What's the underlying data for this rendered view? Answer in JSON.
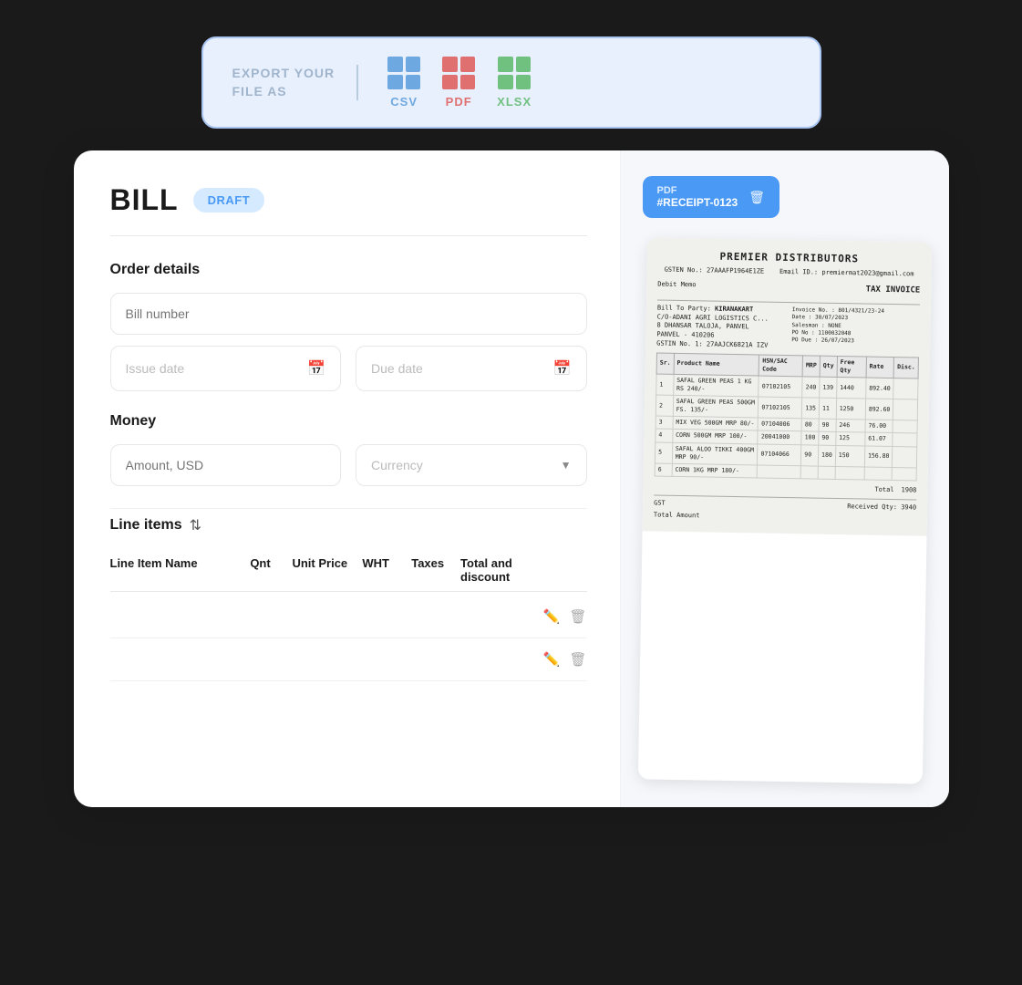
{
  "export_bar": {
    "label": "EXPORT YOUR\nFILE AS",
    "options": [
      {
        "id": "csv",
        "label": "CSV"
      },
      {
        "id": "pdf",
        "label": "PDF"
      },
      {
        "id": "xlsx",
        "label": "XLSX"
      }
    ]
  },
  "bill": {
    "title": "BILL",
    "status": "DRAFT",
    "order_details": {
      "section_title": "Order details",
      "bill_number_placeholder": "Bill number",
      "issue_date_placeholder": "Issue date",
      "due_date_placeholder": "Due date"
    },
    "money": {
      "section_title": "Money",
      "amount_placeholder": "Amount, USD",
      "currency_placeholder": "Currency"
    },
    "line_items": {
      "section_title": "Line items",
      "columns": [
        {
          "id": "name",
          "label": "Line Item Name"
        },
        {
          "id": "qnt",
          "label": "Qnt"
        },
        {
          "id": "unit_price",
          "label": "Unit Price"
        },
        {
          "id": "wht",
          "label": "WHT"
        },
        {
          "id": "taxes",
          "label": "Taxes"
        },
        {
          "id": "total",
          "label": "Total and discount"
        },
        {
          "id": "actions",
          "label": ""
        }
      ],
      "rows": [
        {
          "name": "",
          "qnt": "",
          "unit_price": "",
          "wht": "",
          "taxes": "",
          "total": ""
        },
        {
          "name": "",
          "qnt": "",
          "unit_price": "",
          "wht": "",
          "taxes": "",
          "total": ""
        }
      ]
    }
  },
  "receipt": {
    "pdf_label": "PDF",
    "receipt_id": "#RECEIPT-0123",
    "company": "PREMIER DISTRIBUTORS",
    "gst": "27AAAFP1964E1ZE",
    "email": "premiermat2023@gmail.com",
    "doc_type": "TAX INVOICE",
    "memo": "Debit Memo",
    "bill_to": "KIRANAKART",
    "invoice_no": "801/4321/23-24",
    "date": "30/07/2023",
    "salesman": "NONE",
    "po_no": "1100032048",
    "po_due": "26/07/2023",
    "gstin": "27AAJCK6821A 12V"
  }
}
